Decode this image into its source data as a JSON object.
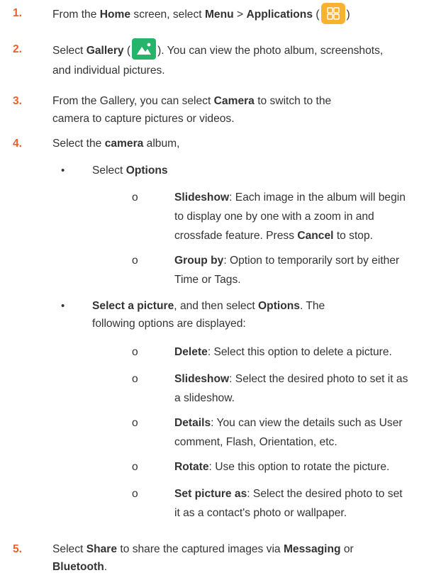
{
  "steps": [
    {
      "num": "1.",
      "parts": [
        "From the ",
        "Home",
        " screen, select ",
        "Menu",
        " > ",
        "Applications",
        " (",
        ")"
      ]
    },
    {
      "num": "2.",
      "parts": [
        "Select ",
        "Gallery",
        " (",
        "). You can view the photo album, screenshots,",
        "and individual pictures."
      ]
    },
    {
      "num": "3.",
      "parts": [
        "From the Gallery, you can select ",
        "Camera",
        " to switch to the",
        "camera to capture pictures or videos."
      ]
    },
    {
      "num": "4.",
      "parts": [
        "Select the ",
        "camera",
        " album,"
      ]
    },
    {
      "num": "5.",
      "parts": [
        "Select ",
        "Share",
        " to share the captured images via ",
        "Messaging",
        " or",
        "Bluetooth",
        "."
      ]
    }
  ],
  "bullets": [
    {
      "mark": "•",
      "parts": [
        "Select ",
        "Options"
      ]
    },
    {
      "mark": "•",
      "parts": [
        "Select a picture",
        ", and then select ",
        "Options",
        ". The",
        "following options are displayed:"
      ]
    }
  ],
  "options_group1": [
    {
      "mark": "o",
      "term": "Slideshow",
      "lines": [
        ": Each image in the album will begin",
        "to display one by one with a zoom in and",
        "crossfade feature. Press "
      ],
      "term2": "Cancel",
      "tail": " to stop."
    },
    {
      "mark": "o",
      "term": "Group by",
      "lines": [
        ": Option to temporarily sort by either",
        "Time or Tags."
      ]
    }
  ],
  "options_group2": [
    {
      "mark": "o",
      "term": "Delete",
      "lines": [
        ": Select this option to delete a picture."
      ]
    },
    {
      "mark": "o",
      "term": "Slideshow",
      "lines": [
        ": Select the desired photo to set it as",
        "a slideshow."
      ]
    },
    {
      "mark": "o",
      "term": "Details",
      "lines": [
        ": You can view the details such as User",
        "comment, Flash, Orientation, etc."
      ]
    },
    {
      "mark": "o",
      "term": "Rotate",
      "lines": [
        ": Use this option to rotate the picture."
      ]
    },
    {
      "mark": "o",
      "term": "Set picture as",
      "lines": [
        ": Select the desired photo to set",
        "it as a contact's photo or wallpaper."
      ]
    }
  ],
  "colors": {
    "number": "#e8602c",
    "apps_icon": "#f8b230",
    "gallery_icon": "#26b36a"
  },
  "icons": {
    "applications": "apps-grid-icon",
    "gallery": "gallery-image-icon"
  }
}
